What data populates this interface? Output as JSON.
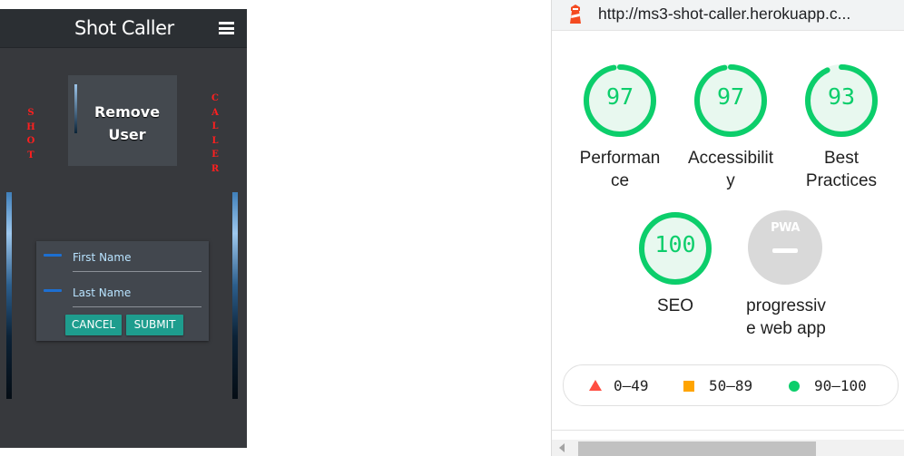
{
  "app": {
    "title": "Shot Caller",
    "side_text_left": "S\nH\nO\nT",
    "side_text_right": "C\nA\nL\nL\nE\nR",
    "remove_card": {
      "label": "Remove\nUser"
    },
    "form": {
      "first_name_label": "First Name",
      "last_name_label": "Last Name",
      "cancel_label": "CANCEL",
      "submit_label": "SUBMIT"
    }
  },
  "lighthouse": {
    "url": "http://ms3-shot-caller.herokuapp.c...",
    "categories": [
      {
        "score": "97",
        "label": "Performan\nce"
      },
      {
        "score": "97",
        "label": "Accessibilit\ny"
      },
      {
        "score": "93",
        "label": "Best\nPractices"
      },
      {
        "score": "100",
        "label": "SEO"
      },
      {
        "score": "",
        "badge": "PWA",
        "label": "progressiv\ne web app"
      }
    ],
    "legend": [
      {
        "range": "0–49",
        "color": "#ff4e42",
        "icon": "triangle-icon"
      },
      {
        "range": "50–89",
        "color": "#ffa400",
        "icon": "square-icon"
      },
      {
        "range": "90–100",
        "color": "#0cce6b",
        "icon": "circle-icon"
      }
    ],
    "gauge_color": "#0cce6b"
  }
}
